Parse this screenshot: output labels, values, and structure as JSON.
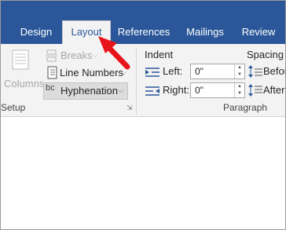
{
  "tabs": [
    {
      "label": "Design"
    },
    {
      "label": "Layout"
    },
    {
      "label": "References"
    },
    {
      "label": "Mailings"
    },
    {
      "label": "Review"
    }
  ],
  "page_setup": {
    "columns_label": "Columns",
    "breaks_label": "Breaks",
    "line_numbers_label": "Line Numbers",
    "hyphenation_label": "Hyphenation",
    "group_label": "Setup"
  },
  "paragraph": {
    "indent_label": "Indent",
    "left_label": "Left:",
    "left_value": "0\"",
    "right_label": "Right:",
    "right_value": "0\"",
    "spacing_label": "Spacing",
    "before_label": "Before",
    "after_label": "After:",
    "group_label": "Paragraph"
  },
  "colors": {
    "tab_bar": "#2b579a",
    "ribbon": "#f3f3f3",
    "callout_arrow": "#e8141b"
  }
}
